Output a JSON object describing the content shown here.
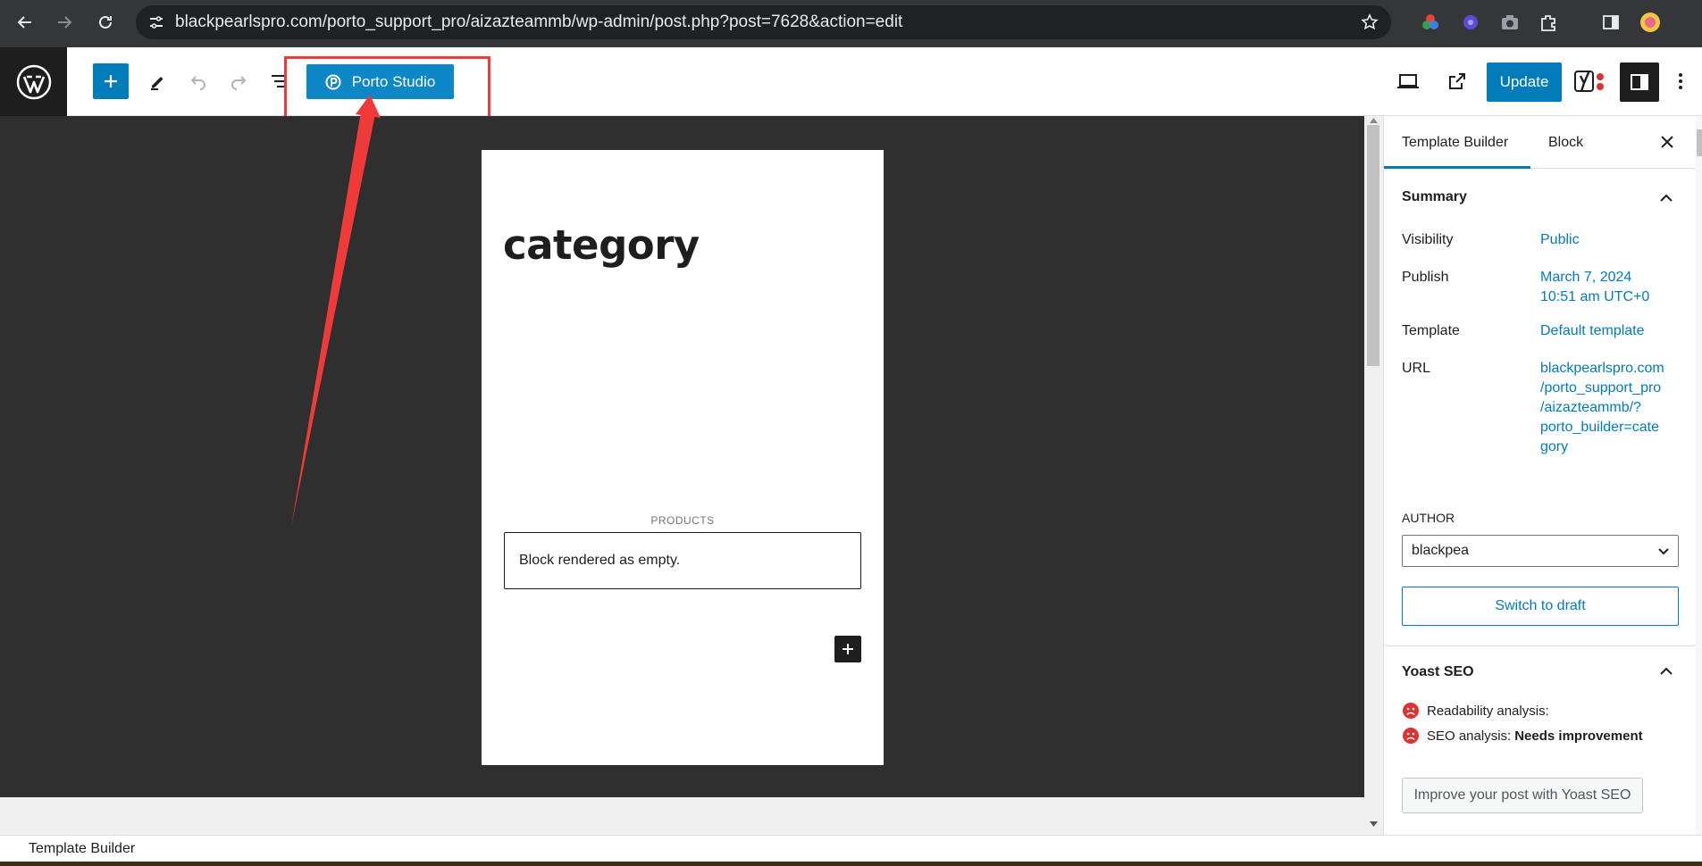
{
  "browser": {
    "url": "blackpearlspro.com/porto_support_pro/aizazteammb/wp-admin/post.php?post=7628&action=edit"
  },
  "toolbar": {
    "porto_label": "Porto Studio",
    "update_label": "Update"
  },
  "canvas": {
    "title": "category",
    "products_label": "PRODUCTS",
    "empty_text": "Block rendered as empty."
  },
  "sidebar": {
    "tabs": [
      "Template Builder",
      "Block"
    ],
    "summary": {
      "title": "Summary",
      "rows": [
        {
          "label": "Visibility",
          "value": "Public"
        },
        {
          "label": "Publish",
          "value": "March 7, 2024",
          "value2": "10:51 am UTC+0"
        },
        {
          "label": "Template",
          "value": "Default template"
        },
        {
          "label": "URL",
          "lines": [
            "blackpearlspro.com",
            "/porto_support_pro",
            "/aizazteammb/?",
            "porto_builder=cate",
            "gory"
          ]
        }
      ],
      "author_label": "AUTHOR",
      "author_value": "blackpea",
      "switch_draft": "Switch to draft"
    },
    "yoast": {
      "title": "Yoast SEO",
      "readability_label": "Readability analysis:",
      "seo_label": "SEO analysis:",
      "seo_value": "Needs improvement",
      "button": "Improve your post with Yoast SEO"
    }
  },
  "footer": {
    "breadcrumb": "Template Builder"
  },
  "colors": {
    "wp_blue": "#007cba",
    "porto_blue": "#0d87c6",
    "highlight_red": "#f03a3a",
    "yoast_bad": "#dc3232"
  }
}
